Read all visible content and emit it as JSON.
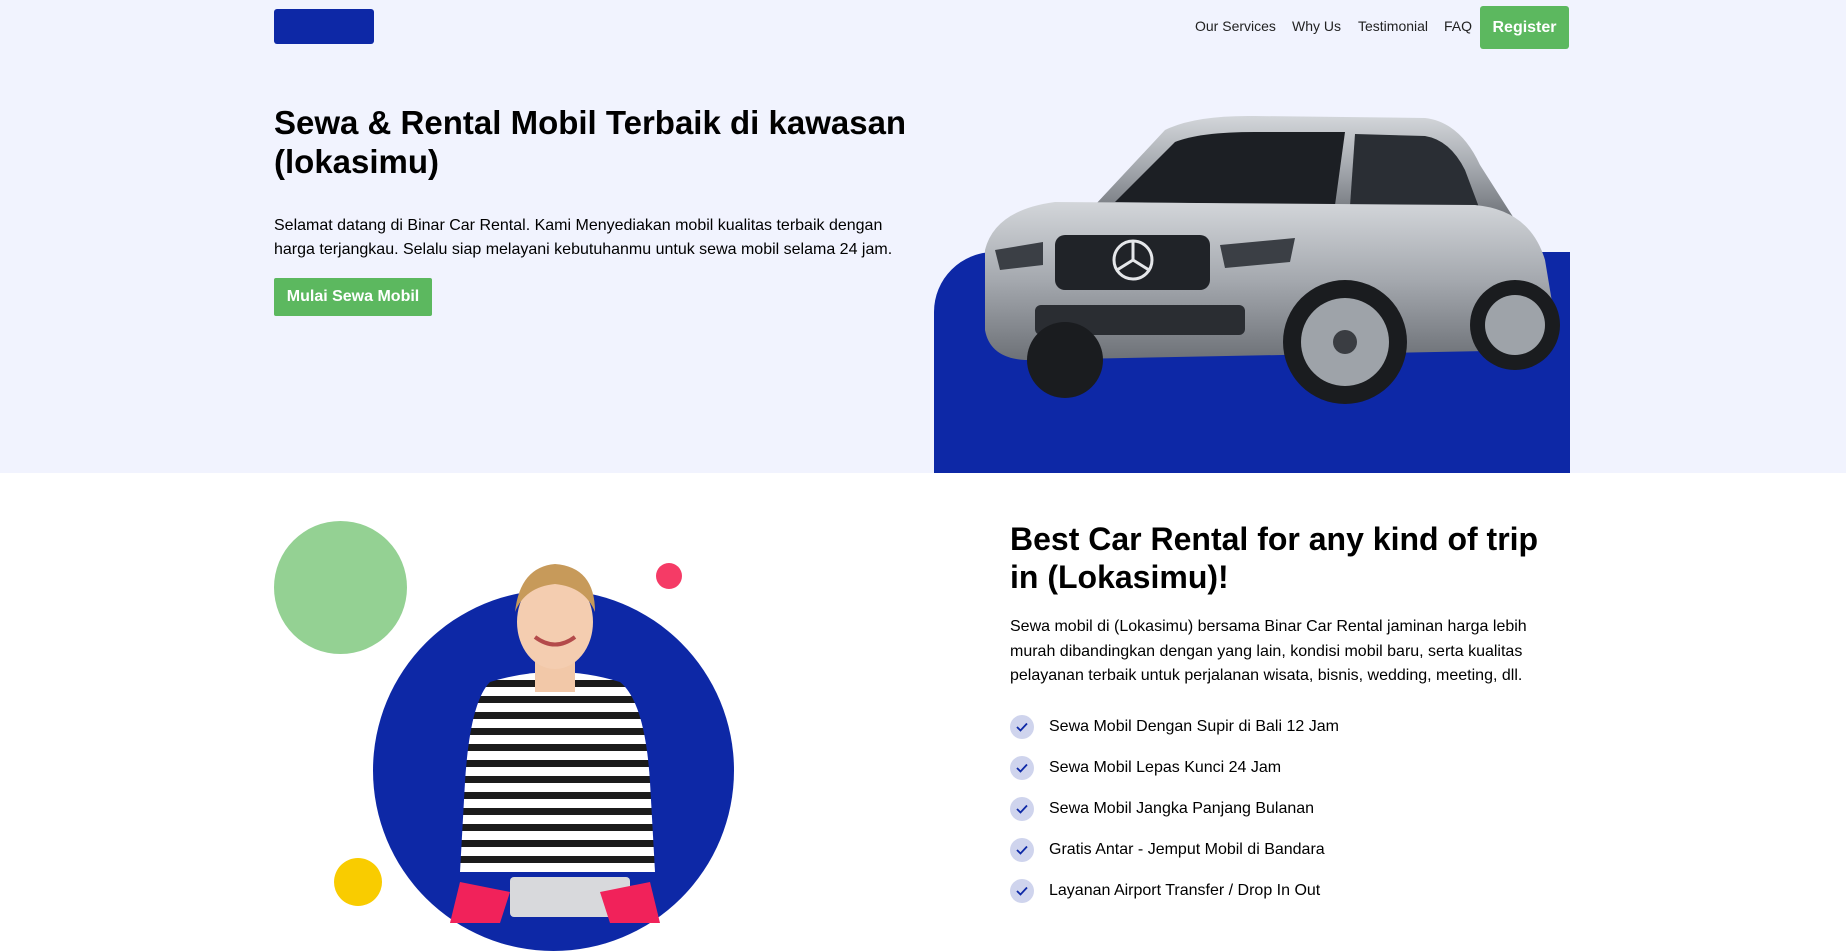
{
  "nav": {
    "links": [
      "Our Services",
      "Why Us",
      "Testimonial",
      "FAQ"
    ],
    "register_label": "Register"
  },
  "hero": {
    "title": "Sewa & Rental Mobil Terbaik di kawasan (lokasimu)",
    "description": "Selamat datang di Binar Car Rental. Kami Menyediakan mobil kualitas terbaik dengan harga terjangkau. Selalu siap melayani kebutuhanmu untuk sewa mobil selama 24 jam.",
    "cta_label": "Mulai Sewa Mobil"
  },
  "services": {
    "title": "Best Car Rental for any kind of trip in (Lokasimu)!",
    "description": "Sewa mobil di (Lokasimu) bersama Binar Car Rental jaminan harga lebih murah dibandingkan dengan yang lain, kondisi mobil baru, serta kualitas pelayanan terbaik untuk perjalanan wisata, bisnis, wedding, meeting, dll.",
    "features": [
      "Sewa Mobil Dengan Supir di Bali 12 Jam",
      "Sewa Mobil Lepas Kunci 24 Jam",
      "Sewa Mobil Jangka Panjang Bulanan",
      "Gratis Antar - Jemput Mobil di Bandara",
      "Layanan Airport Transfer / Drop In Out"
    ]
  },
  "colors": {
    "brand_blue": "#0d28a6",
    "accent_green": "#5cb85f",
    "hero_background": "#f1f3fe"
  },
  "icons": [
    "check-icon",
    "car-image",
    "woman-image"
  ]
}
